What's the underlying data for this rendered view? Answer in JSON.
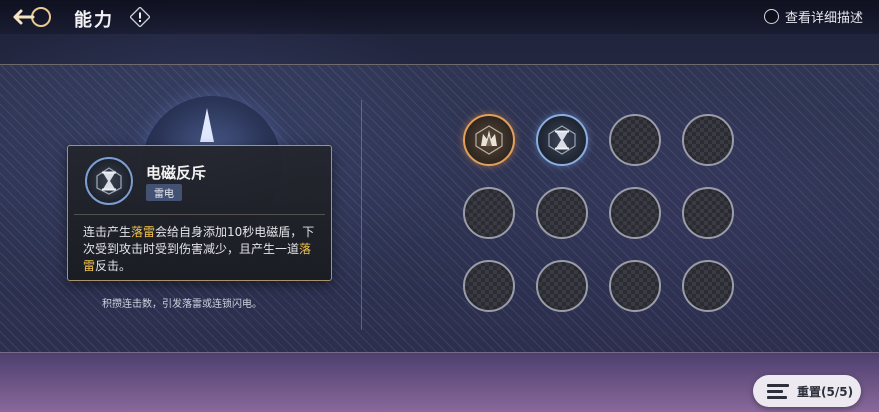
{
  "header": {
    "title": "能力",
    "info_icon": "exclamation-icon",
    "back_icon": "back-arrow-icon",
    "detail_toggle_label": "查看详细描述"
  },
  "tooltip": {
    "skill_name": "电磁反斥",
    "skill_tag": "雷电",
    "description_parts": [
      {
        "text": "连击产生",
        "highlight": false
      },
      {
        "text": "落雷",
        "highlight": true
      },
      {
        "text": "会给自身添加10秒电磁盾，下次受到攻击时受到伤害减少，且产生一道",
        "highlight": false
      },
      {
        "text": "落雷",
        "highlight": true
      },
      {
        "text": "反击。",
        "highlight": false
      }
    ],
    "highlight_color": "#f2c34e"
  },
  "caption": "积攒连击数，引发落雷或连锁闪电。",
  "skill_grid": {
    "rows": 3,
    "cols": 4,
    "nodes": [
      {
        "state": "gold",
        "icon": "crown-shield-icon"
      },
      {
        "state": "blue",
        "icon": "hourglass-icon"
      },
      {
        "state": "empty"
      },
      {
        "state": "empty"
      },
      {
        "state": "empty"
      },
      {
        "state": "empty"
      },
      {
        "state": "empty"
      },
      {
        "state": "empty"
      },
      {
        "state": "empty"
      },
      {
        "state": "empty"
      },
      {
        "state": "empty"
      },
      {
        "state": "empty"
      }
    ]
  },
  "reset": {
    "label": "重置(5/5)",
    "icon": "settings-sliders-icon"
  }
}
